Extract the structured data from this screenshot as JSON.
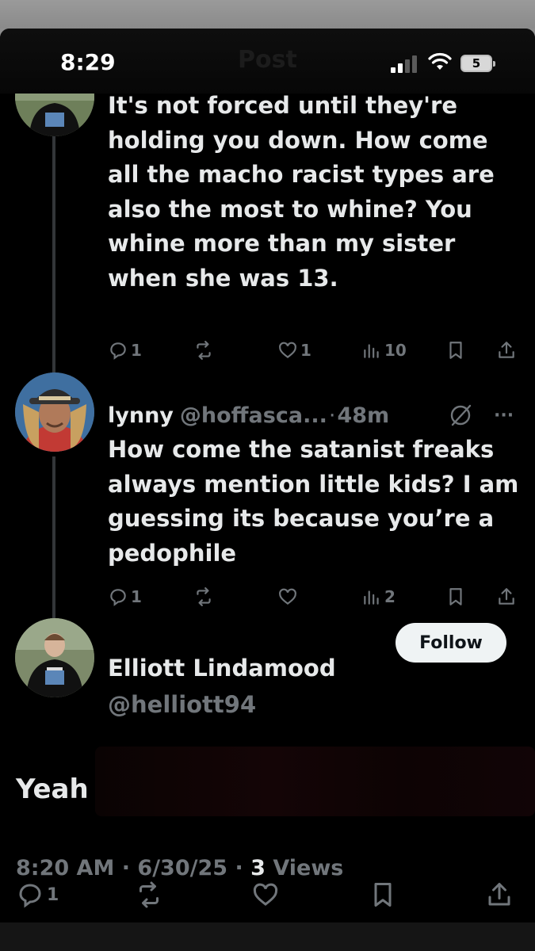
{
  "status_bar": {
    "time": "8:29",
    "battery": "5"
  },
  "ghost_header": "Post",
  "reply1": {
    "text": "It's not forced until they're holding you down. How come all the macho racist types are also the most to whine? You whine more than my sister when she was 13.",
    "replies": "1",
    "likes": "1",
    "views": "10"
  },
  "reply2": {
    "name": "lynny",
    "handle": "@hoffasca...",
    "sep": "·",
    "time": "48m",
    "more": "···",
    "text": "How come the satanist freaks always mention little kids? I am guessing its because you’re a pedophile",
    "replies": "1",
    "views": "2"
  },
  "main_post": {
    "name": "Elliott Lindamood",
    "handle": "@helliott94",
    "follow_label": "Follow",
    "text": "Yeah",
    "meta_time": "8:20 AM",
    "meta_sep1": "·",
    "meta_date": "6/30/25",
    "meta_sep2": "·",
    "views_count": "3",
    "views_label": "Views",
    "replies": "1"
  },
  "colors": {
    "background": "#000000",
    "text_primary": "#e7e9ea",
    "text_secondary": "#71767b",
    "follow_button": "#eff3f4"
  },
  "icons": [
    "reply-icon",
    "repost-icon",
    "like-icon",
    "views-icon",
    "bookmark-icon",
    "share-icon",
    "grok-icon",
    "more-icon"
  ]
}
